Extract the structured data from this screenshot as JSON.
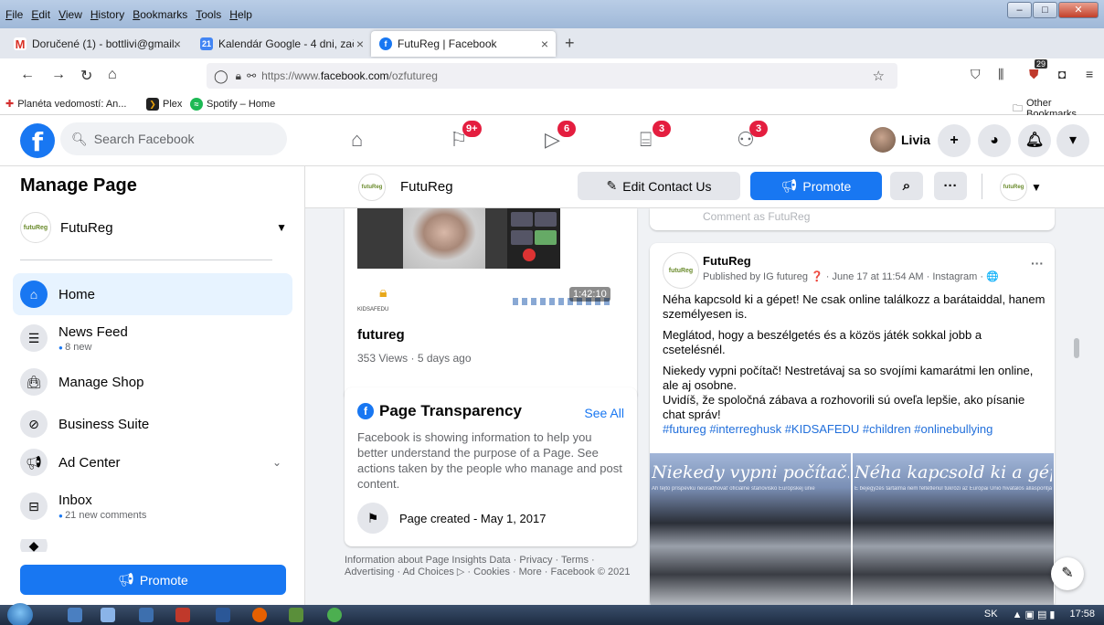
{
  "browser": {
    "menu": [
      "File",
      "Edit",
      "View",
      "History",
      "Bookmarks",
      "Tools",
      "Help"
    ],
    "tabs": [
      {
        "label": "Doručené (1) - bottlivi@gmail.c",
        "icon": "gmail-icon"
      },
      {
        "label": "Kalendár Google - 4 dni, začína",
        "icon": "calendar-icon"
      },
      {
        "label": "FutuReg | Facebook",
        "icon": "facebook-icon"
      }
    ],
    "url_prefix": "https://www.",
    "url_domain": "facebook.com",
    "url_path": "/ozfutureg",
    "bookmarks": [
      "Planéta vedomostí: An...",
      "Plex",
      "Spotify – Home"
    ],
    "other_bookmarks": "Other Bookmarks",
    "toolbar_badge": "29"
  },
  "fb": {
    "search_placeholder": "Search Facebook",
    "badges": {
      "pages": "9+",
      "watch": "6",
      "marketplace": "3",
      "groups": "3"
    },
    "user_name": "Livia"
  },
  "sidebar": {
    "title": "Manage Page",
    "page_name": "FutuReg",
    "items": [
      {
        "label": "Home",
        "sub": ""
      },
      {
        "label": "News Feed",
        "sub": "8 new"
      },
      {
        "label": "Manage Shop",
        "sub": ""
      },
      {
        "label": "Business Suite",
        "sub": ""
      },
      {
        "label": "Ad Center",
        "sub": ""
      },
      {
        "label": "Inbox",
        "sub": "21 new comments"
      }
    ],
    "promote": "Promote"
  },
  "page_header": {
    "name": "FutuReg",
    "edit_contact": "Edit Contact Us",
    "promote": "Promote"
  },
  "video": {
    "title": "futureg",
    "meta": "353 Views · 5 days ago",
    "duration": "1:42:10",
    "banner_text": "KIDSAFEDU"
  },
  "transparency": {
    "title": "Page Transparency",
    "see_all": "See All",
    "body": "Facebook is showing information to help you better understand the purpose of a Page. See actions taken by the people who manage and post content.",
    "created": "Page created - May 1, 2017"
  },
  "footer": "Information about Page Insights Data · Privacy · Terms · Advertising · Ad Choices ▷ · Cookies · More · Facebook © 2021",
  "comment_placeholder": "Comment as FutuReg",
  "post": {
    "author": "FutuReg",
    "meta": "Published by IG futureg ❓ · June 17 at 11:54 AM · Instagram · 🌐",
    "p1": "Néha kapcsold ki a gépet!  Ne csak online találkozz a barátaiddal, hanem személyesen is.",
    "p2": "Meglátod, hogy a beszélgetés és a közös játék sokkal jobb a csetelésnél.",
    "p3": " Niekedy vypni počítač! Nestretávaj sa so svojími kamarátmi len online, ale aj osobne.",
    "p4": "Uvidíš, že spoločná zábava a rozhovorili sú oveľa lepšie, ako písanie chat správ!",
    "tags": "#futureg #interreghusk #KIDSAFEDU #children #onlinebullying",
    "img1_caption": "Niekedy vypni počítač!",
    "img2_caption": "Néha kapcsold ki a gépet!"
  },
  "taskbar": {
    "lang": "SK",
    "time": "17:58"
  },
  "colors": {
    "fb_blue": "#1877f2",
    "badge_red": "#e41e3f"
  }
}
